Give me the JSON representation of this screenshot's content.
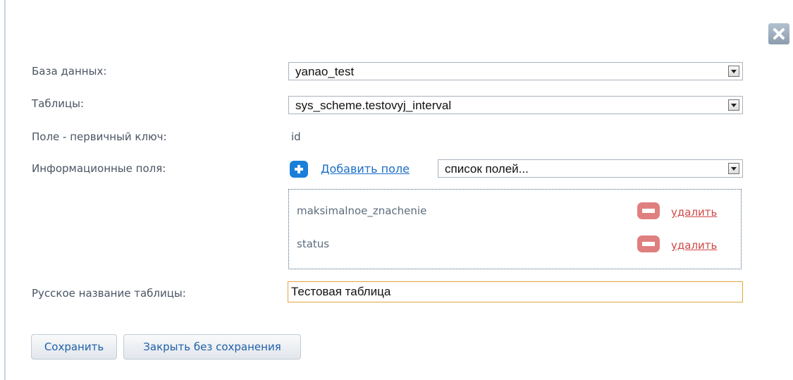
{
  "form": {
    "database_label": "База данных:",
    "database_value": "yanao_test",
    "tables_label": "Таблицы:",
    "tables_value": "sys_scheme.testovyj_interval",
    "pk_label": "Поле - первичный ключ:",
    "pk_value": "id",
    "info_fields_label": "Информационные поля:",
    "add_field_link": "Добавить поле",
    "fields_select_value": "список полей...",
    "fields": [
      {
        "name": "maksimalnoe_znachenie",
        "remove_label": "удалить"
      },
      {
        "name": "status",
        "remove_label": "удалить"
      }
    ],
    "russian_name_label": "Русское название таблицы:",
    "russian_name_value": "Тестовая таблица"
  },
  "buttons": {
    "save": "Сохранить",
    "close_without_save": "Закрыть без сохранения"
  },
  "icons": {
    "close": "close-icon",
    "add": "plus-icon",
    "remove": "minus-icon",
    "dropdown": "chevron-down-icon"
  },
  "colors": {
    "accent_blue": "#1a7fd8",
    "remove_red": "#e07f80",
    "link_red": "#d04848",
    "focus_border": "#e1a63a"
  }
}
